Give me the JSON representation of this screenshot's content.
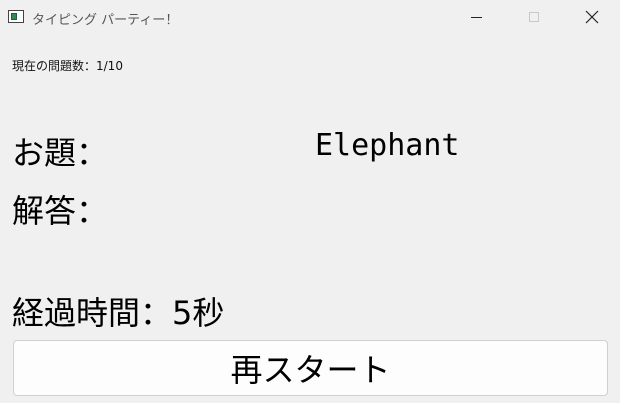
{
  "window": {
    "title": "タイピング パーティー！",
    "controls": {
      "minimize": "minimize-icon",
      "maximize": "maximize-icon",
      "close": "close-icon"
    }
  },
  "status": {
    "question_count": "現在の問題数：1/10"
  },
  "question": {
    "label": "お題：",
    "word": "Elephant"
  },
  "answer": {
    "label": "解答："
  },
  "timer": {
    "text": "経過時間：5秒"
  },
  "actions": {
    "restart_label": "再スタート"
  }
}
